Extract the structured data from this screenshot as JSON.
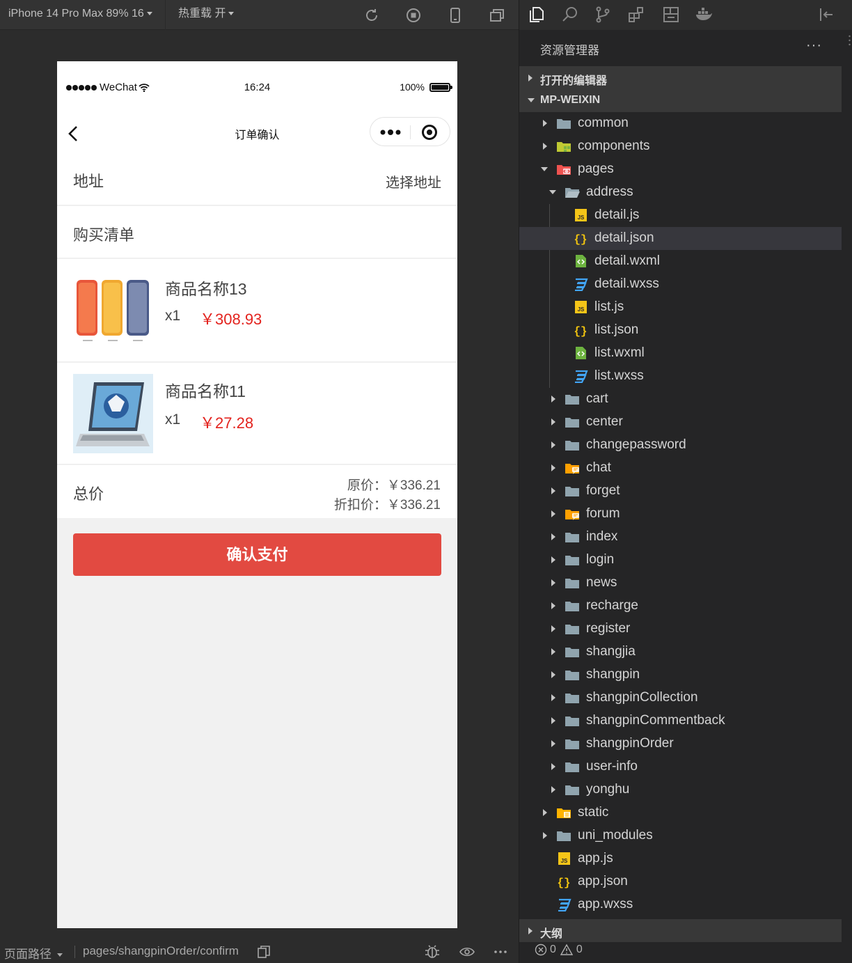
{
  "toolbar": {
    "device_label": "iPhone 14 Pro Max 89% 16",
    "hot_reload_label": "热重载 开",
    "icons": [
      "refresh-icon",
      "stop-icon",
      "phone-icon",
      "window-icon"
    ]
  },
  "phone": {
    "status": {
      "carrier": "WeChat",
      "time": "16:24",
      "battery": "100%"
    },
    "nav_title": "订单确认",
    "address": {
      "label": "地址",
      "action": "选择地址"
    },
    "list_title": "购买清单",
    "items": [
      {
        "name": "商品名称13",
        "qty": "x1",
        "price": "￥308.93"
      },
      {
        "name": "商品名称11",
        "qty": "x1",
        "price": "￥27.28"
      }
    ],
    "total": {
      "label": "总价",
      "original": "原价：￥336.21",
      "discount": "折扣价：￥336.21"
    },
    "pay_button": "确认支付"
  },
  "sim_status": {
    "path_label": "页面路径",
    "path": "pages/shangpinOrder/confirm"
  },
  "explorer": {
    "title": "资源管理器",
    "more": "···",
    "open_editors": "打开的编辑器",
    "project": "MP-WEIXIN",
    "tree": [
      {
        "label": "common"
      },
      {
        "label": "components"
      },
      {
        "label": "pages"
      },
      {
        "label": "address"
      },
      {
        "label": "detail.js"
      },
      {
        "label": "detail.json"
      },
      {
        "label": "detail.wxml"
      },
      {
        "label": "detail.wxss"
      },
      {
        "label": "list.js"
      },
      {
        "label": "list.json"
      },
      {
        "label": "list.wxml"
      },
      {
        "label": "list.wxss"
      },
      {
        "label": "cart"
      },
      {
        "label": "center"
      },
      {
        "label": "changepassword"
      },
      {
        "label": "chat"
      },
      {
        "label": "forget"
      },
      {
        "label": "forum"
      },
      {
        "label": "index"
      },
      {
        "label": "login"
      },
      {
        "label": "news"
      },
      {
        "label": "recharge"
      },
      {
        "label": "register"
      },
      {
        "label": "shangjia"
      },
      {
        "label": "shangpin"
      },
      {
        "label": "shangpinCollection"
      },
      {
        "label": "shangpinCommentback"
      },
      {
        "label": "shangpinOrder"
      },
      {
        "label": "user-info"
      },
      {
        "label": "yonghu"
      },
      {
        "label": "static"
      },
      {
        "label": "uni_modules"
      },
      {
        "label": "app.js"
      },
      {
        "label": "app.json"
      },
      {
        "label": "app.wxss"
      }
    ],
    "outline": "大纲",
    "errors": "0",
    "warnings": "0"
  },
  "colors": {
    "accent_red": "#e24a41",
    "price_red": "#e3231e",
    "folder_blue": "#90a4ae",
    "js_yellow": "#f5c518",
    "json_yellow": "#f1c40f",
    "wxml_green": "#6db33f",
    "wxss_blue": "#42a5f5"
  }
}
